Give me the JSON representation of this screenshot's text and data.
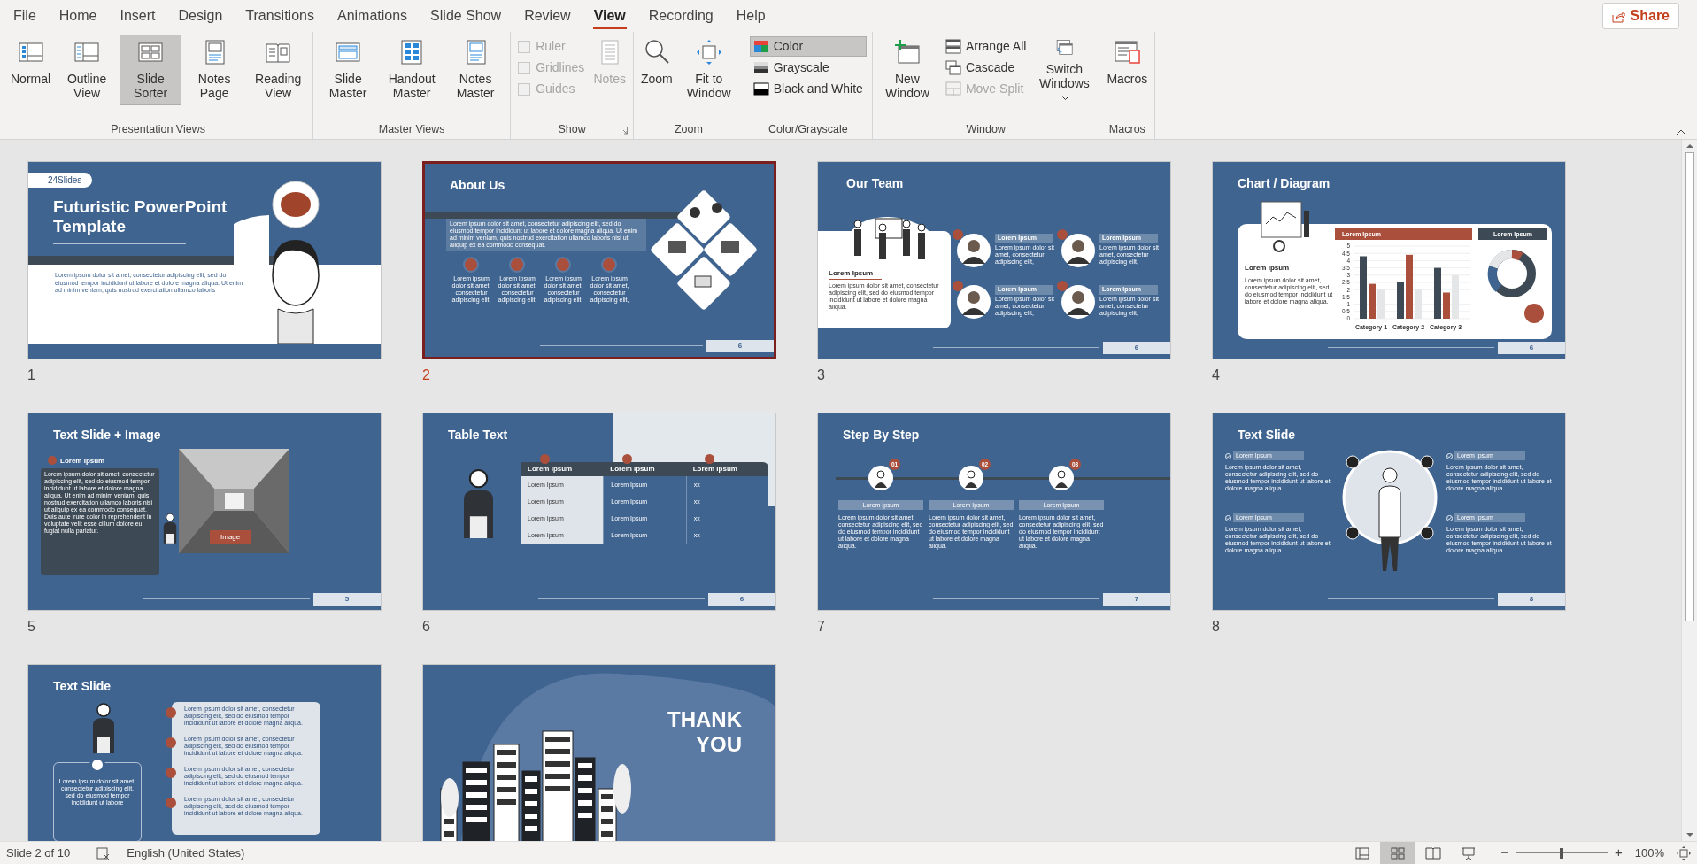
{
  "tabs": [
    {
      "label": "File",
      "selected": false
    },
    {
      "label": "Home",
      "selected": false
    },
    {
      "label": "Insert",
      "selected": false
    },
    {
      "label": "Design",
      "selected": false
    },
    {
      "label": "Transitions",
      "selected": false
    },
    {
      "label": "Animations",
      "selected": false
    },
    {
      "label": "Slide Show",
      "selected": false
    },
    {
      "label": "Review",
      "selected": false
    },
    {
      "label": "View",
      "selected": true
    },
    {
      "label": "Recording",
      "selected": false
    },
    {
      "label": "Help",
      "selected": false
    }
  ],
  "share": "Share",
  "ribbon": [
    {
      "label": "Presentation Views",
      "items": [
        {
          "kind": "normal",
          "label": "Normal",
          "selected": false
        },
        {
          "kind": "outline",
          "label": "Outline View",
          "selected": false
        },
        {
          "kind": "sorter",
          "label": "Slide Sorter",
          "selected": true
        },
        {
          "kind": "notes_page",
          "label": "Notes Page",
          "selected": false
        },
        {
          "kind": "reading",
          "label": "Reading View",
          "selected": false
        }
      ]
    },
    {
      "label": "Master Views",
      "items": [
        {
          "kind": "slide_master",
          "label": "Slide Master"
        },
        {
          "kind": "handout_master",
          "label": "Handout Master"
        },
        {
          "kind": "notes_master",
          "label": "Notes Master"
        }
      ]
    },
    {
      "label": "Show",
      "launcher": true,
      "items": [
        {
          "kind": "checkbox",
          "label": "Ruler",
          "checked": false,
          "disabled": true
        },
        {
          "kind": "checkbox",
          "label": "Gridlines",
          "checked": false,
          "disabled": true
        },
        {
          "kind": "checkbox",
          "label": "Guides",
          "checked": false,
          "disabled": true
        },
        {
          "kind": "notes",
          "label": "Notes",
          "disabled": true
        }
      ]
    },
    {
      "label": "Zoom",
      "items": [
        {
          "kind": "zoom",
          "label": "Zoom"
        },
        {
          "kind": "fit",
          "label": "Fit to Window"
        }
      ]
    },
    {
      "label": "Color/Grayscale",
      "items": [
        {
          "kind": "color",
          "label": "Color",
          "selected": true
        },
        {
          "kind": "grayscale",
          "label": "Grayscale",
          "selected": false
        },
        {
          "kind": "black_white",
          "label": "Black and White",
          "selected": false
        }
      ]
    },
    {
      "label": "Window",
      "items": [
        {
          "kind": "new_window",
          "label": "New Window",
          "disabled": false
        },
        {
          "kind": "arrange",
          "label": "Arrange All",
          "disabled": false
        },
        {
          "kind": "cascade",
          "label": "Cascade",
          "disabled": false
        },
        {
          "kind": "move_split",
          "label": "Move Split",
          "disabled": true
        },
        {
          "kind": "switch",
          "label": "Switch Windows",
          "disabled": false
        }
      ]
    },
    {
      "label": "Macros",
      "items": [
        {
          "kind": "macros",
          "label": "Macros"
        }
      ]
    }
  ],
  "slides": [
    {
      "number": "1",
      "selected": false,
      "kind": "title",
      "logo": "24Slides",
      "title": "Futuristic PowerPoint Template",
      "body": "Lorem ipsum dolor sit amet, consectetur adipiscing elit, sed do eiusmod tempor incididunt ut labore et dolore magna aliqua. Ut enim ad minim veniam, quis nostrud exercitation ullamco laboris"
    },
    {
      "number": "2",
      "selected": true,
      "kind": "about",
      "title": "About Us",
      "body": "Lorem ipsum dolor sit amet, consectetur adipiscing elit, sed do eiusmod tempor incididunt ut labore et dolore magna aliqua. Ut enim ad minim veniam, quis nostrud exercitation ullamco laboris nisi ut aliquip ex ea commodo consequat.",
      "features": [
        "Lorem ipsum dolor sit amet, consectetur adipiscing elit,",
        "Lorem ipsum dolor sit amet, consectetur adipiscing elit,",
        "Lorem ipsum dolor sit amet, consectetur adipiscing elit,",
        "Lorem ipsum dolor sit amet, consectetur adipiscing elit,"
      ],
      "page": "6"
    },
    {
      "number": "3",
      "selected": false,
      "kind": "team",
      "title": "Our Team",
      "card_title": "Lorem Ipsum",
      "card_body": "Lorem ipsum dolor sit amet, consectetur adipiscing elit, sed do eiusmod tempor incididunt ut labore et dolore magna aliqua.",
      "members": [
        {
          "name": "Lorem Ipsum",
          "text": "Lorem ipsum dolor sit amet, consectetur adipiscing elit,"
        },
        {
          "name": "Lorem Ipsum",
          "text": "Lorem ipsum dolor sit amet, consectetur adipiscing elit,"
        },
        {
          "name": "Lorem Ipsum",
          "text": "Lorem ipsum dolor sit amet, consectetur adipiscing elit,"
        },
        {
          "name": "Lorem Ipsum",
          "text": "Lorem ipsum dolor sit amet, consectetur adipiscing elit,"
        }
      ],
      "page": "6"
    },
    {
      "number": "4",
      "selected": false,
      "kind": "chart",
      "title": "Chart / Diagram",
      "card_title": "Lorem Ipsum",
      "card_body": "Lorem ipsum dolor sit amet, consectetur adipiscing elit, sed do eiusmod tempor incididunt ut labore et dolore magna aliqua.",
      "chart_header": "Lorem Ipsum",
      "donut_header": "Lorem Ipsum",
      "page": "6",
      "chart_data": {
        "type": "bar",
        "grid": true,
        "categories": [
          "Category 1",
          "Category 2",
          "Category 3"
        ],
        "ylim": [
          0,
          5
        ],
        "yticks": [
          0,
          0.5,
          1,
          1.5,
          2,
          2.5,
          3,
          3.5,
          4,
          4.5,
          5
        ],
        "series": [
          {
            "color": "#3d4a55",
            "values": [
              4.3,
              2.5,
              3.5
            ]
          },
          {
            "color": "#a94f3c",
            "values": [
              2.4,
              4.4,
              1.8
            ]
          },
          {
            "color": "#e4e6e8",
            "values": [
              2,
              2,
              3
            ]
          }
        ]
      }
    },
    {
      "number": "5",
      "selected": false,
      "kind": "text_image",
      "title": "Text Slide + Image",
      "heading": "Lorem Ipsum",
      "body": "Lorem ipsum dolor sit amet, consectetur adipiscing elit, sed do eiusmod tempor incididunt ut labore et dolore magna aliqua. Ut enim ad minim veniam, quis nostrud exercitation ullamco laboris nisi ut aliquip ex ea commodo consequat. Duis aute irure dolor in reprehenderit in voluptate velit esse cillum dolore eu fugiat nulla pariatur.",
      "button": "Image",
      "page": "5"
    },
    {
      "number": "6",
      "selected": false,
      "kind": "table",
      "title": "Table Text",
      "columns": [
        "Lorem Ipsum",
        "Lorem Ipsum",
        "Lorem Ipsum"
      ],
      "rows": [
        [
          "Lorem Ipsum",
          "Lorem Ipsum",
          "xx"
        ],
        [
          "Lorem Ipsum",
          "Lorem Ipsum",
          "xx"
        ],
        [
          "Lorem Ipsum",
          "Lorem Ipsum",
          "xx"
        ],
        [
          "Lorem Ipsum",
          "Lorem Ipsum",
          "xx"
        ]
      ],
      "page": "6"
    },
    {
      "number": "7",
      "selected": false,
      "kind": "steps",
      "title": "Step By Step",
      "steps": [
        {
          "badge": "01",
          "label": "Lorem Ipsum",
          "text": "Lorem ipsum dolor sit amet, consectetur adipiscing elit, sed do eiusmod tempor incididunt ut labore et dolore magna aliqua."
        },
        {
          "badge": "02",
          "label": "Lorem Ipsum",
          "text": "Lorem ipsum dolor sit amet, consectetur adipiscing elit, sed do eiusmod tempor incididunt ut labore et dolore magna aliqua."
        },
        {
          "badge": "03",
          "label": "Lorem Ipsum",
          "text": "Lorem ipsum dolor sit amet, consectetur adipiscing elit, sed do eiusmod tempor incididunt ut labore et dolore magna aliqua."
        }
      ],
      "page": "7"
    },
    {
      "number": "8",
      "selected": false,
      "kind": "text_circle",
      "title": "Text Slide",
      "items": [
        {
          "label": "Lorem Ipsum",
          "text": "Lorem ipsum dolor sit amet, consectetur adipiscing elit, sed do eiusmod tempor incididunt ut labore et dolore magna aliqua."
        },
        {
          "label": "Lorem Ipsum",
          "text": "Lorem ipsum dolor sit amet, consectetur adipiscing elit, sed do eiusmod tempor incididunt ut labore et dolore magna aliqua."
        },
        {
          "label": "Lorem Ipsum",
          "text": "Lorem ipsum dolor sit amet, consectetur adipiscing elit, sed do eiusmod tempor incididunt ut labore et dolore magna aliqua."
        },
        {
          "label": "Lorem Ipsum",
          "text": "Lorem ipsum dolor sit amet, consectetur adipiscing elit, sed do eiusmod tempor incididunt ut labore et dolore magna aliqua."
        }
      ],
      "page": "8"
    },
    {
      "selected": false,
      "kind": "text_list",
      "title": "Text Slide",
      "rows": [
        "Lorem ipsum dolor sit amet, consectetur adipiscing elit, sed do eiusmod tempor incididunt ut labore et dolore magna aliqua.",
        "Lorem ipsum dolor sit amet, consectetur adipiscing elit, sed do eiusmod tempor incididunt ut labore et dolore magna aliqua.",
        "Lorem ipsum dolor sit amet, consectetur adipiscing elit, sed do eiusmod tempor incididunt ut labore et dolore magna aliqua.",
        "Lorem ipsum dolor sit amet, consectetur adipiscing elit, sed do eiusmod tempor incididunt ut labore et dolore magna aliqua."
      ],
      "card_body": "Lorem ipsum dolor sit amet, consectetur adipiscing elit, sed do eiusmod tempor incididunt ut labore"
    },
    {
      "selected": false,
      "kind": "closing",
      "title": "THANK YOU"
    }
  ],
  "status": {
    "slide_info": "Slide 2 of 10",
    "language": "English (United States)",
    "views": [
      {
        "kind": "normal",
        "selected": false
      },
      {
        "kind": "sorter",
        "selected": true
      },
      {
        "kind": "reading",
        "selected": false
      },
      {
        "kind": "slideshow",
        "selected": false
      }
    ],
    "zoom_out": "−",
    "zoom_in": "+",
    "zoom": {
      "level": 0.5
    },
    "zoom_reading": "100%"
  }
}
